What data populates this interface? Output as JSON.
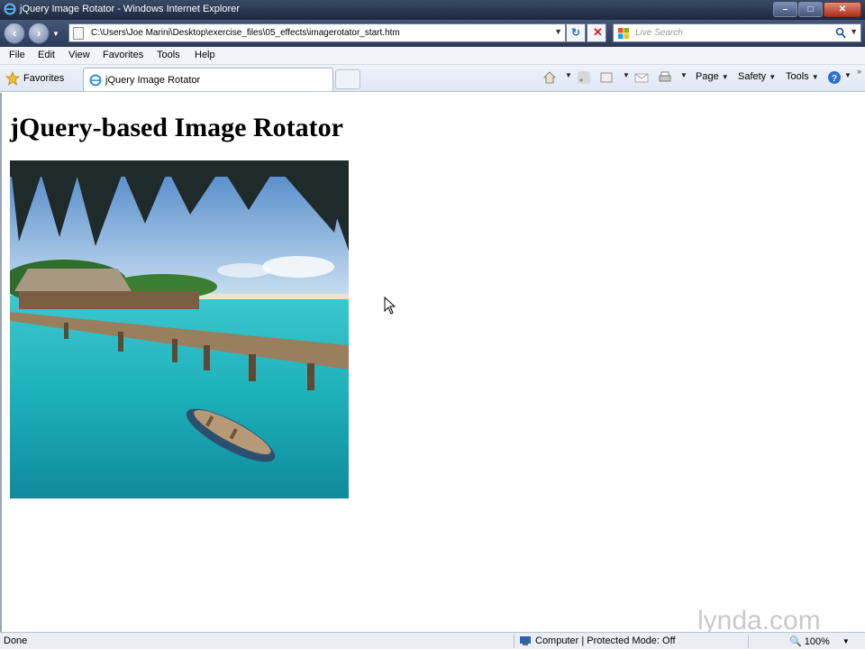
{
  "window": {
    "title": "jQuery Image Rotator - Windows Internet Explorer"
  },
  "address_bar": {
    "url": "C:\\Users\\Joe Marini\\Desktop\\exercise_files\\05_effects\\imagerotator_start.htm"
  },
  "search": {
    "placeholder": "Live Search"
  },
  "menu": {
    "items": [
      "File",
      "Edit",
      "View",
      "Favorites",
      "Tools",
      "Help"
    ]
  },
  "toolbar": {
    "favorites_label": "Favorites",
    "tab_label": "jQuery Image Rotator",
    "page_label": "Page",
    "safety_label": "Safety",
    "tools_label": "Tools"
  },
  "page": {
    "heading": "jQuery-based Image Rotator"
  },
  "status": {
    "left_text": "Done",
    "zone_text": "Computer | Protected Mode: Off",
    "zoom_text": "100%"
  },
  "watermark": "lynda.com",
  "colors": {
    "titlebar": "#1d2740",
    "accent_link": "#2c6cc0",
    "water": "#1fb3bf"
  }
}
